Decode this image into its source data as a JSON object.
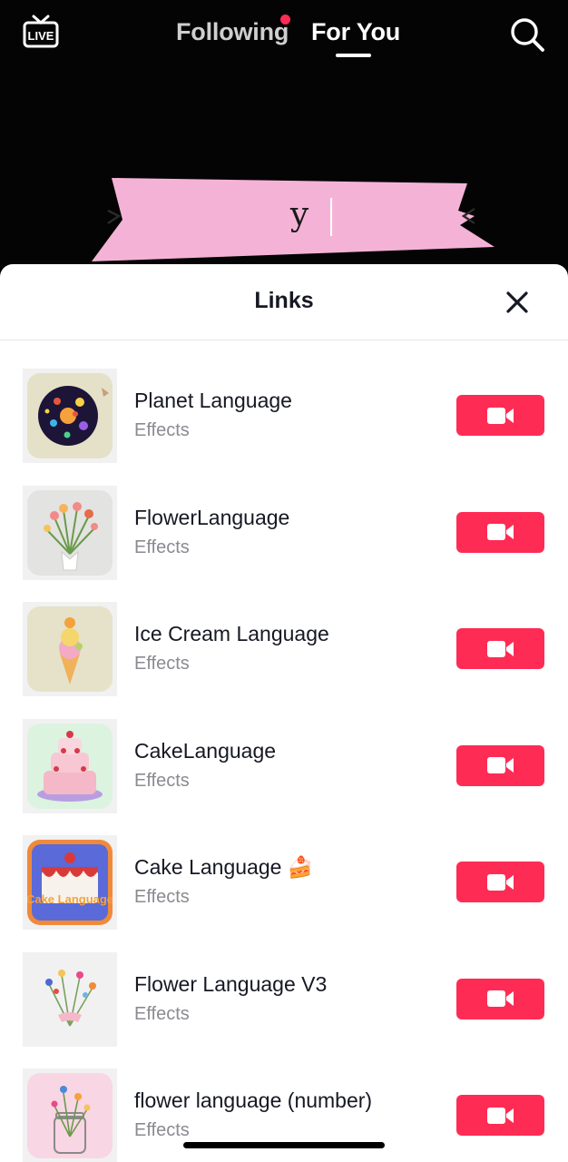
{
  "top_nav": {
    "live_label": "LIVE",
    "tabs": [
      {
        "label": "Following",
        "has_notification_dot": true
      },
      {
        "label": "For You",
        "active": true
      }
    ],
    "icons": [
      "live-icon",
      "search-icon"
    ]
  },
  "video": {
    "banner_text": "y",
    "banner_color": "#f4b3d6"
  },
  "sheet": {
    "title": "Links",
    "close_icon": "close-icon",
    "items": [
      {
        "name": "Planet Language",
        "type": "Effects",
        "action_icon": "video-camera-icon"
      },
      {
        "name": "FlowerLanguage",
        "type": "Effects",
        "action_icon": "video-camera-icon"
      },
      {
        "name": "Ice Cream Language",
        "type": "Effects",
        "action_icon": "video-camera-icon"
      },
      {
        "name": "CakeLanguage",
        "type": "Effects",
        "action_icon": "video-camera-icon"
      },
      {
        "name": "Cake Language 🍰",
        "type": "Effects",
        "action_icon": "video-camera-icon",
        "thumb_text": "Cake Language"
      },
      {
        "name": "Flower Language V3",
        "type": "Effects",
        "action_icon": "video-camera-icon"
      },
      {
        "name": "flower language (number)",
        "type": "Effects",
        "action_icon": "video-camera-icon"
      }
    ]
  },
  "colors": {
    "accent": "#fe2c55",
    "text_primary": "#161823",
    "text_secondary": "#8a8b91"
  }
}
